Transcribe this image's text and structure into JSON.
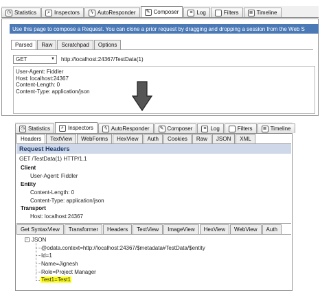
{
  "top": {
    "tabs": [
      {
        "label": "Statistics",
        "icon": "stopwatch-icon"
      },
      {
        "label": "Inspectors",
        "icon": "magnifier-icon"
      },
      {
        "label": "AutoResponder",
        "icon": "lightning-icon"
      },
      {
        "label": "Composer",
        "icon": "pencil-icon",
        "active": true
      },
      {
        "label": "Log",
        "icon": "log-icon"
      },
      {
        "label": "Filters",
        "icon": "checkbox-icon"
      },
      {
        "label": "Timeline",
        "icon": "timeline-icon"
      }
    ],
    "info": "Use this page to compose a Request. You can clone a prior request by dragging and dropping a session from the Web S",
    "subtabs": [
      "Parsed",
      "Raw",
      "Scratchpad",
      "Options"
    ],
    "method": "GET",
    "url": "http://localhost:24367/TestData(1)",
    "headers_text": "User-Agent: Fiddler\nHost: localhost:24367\nContent-Length: 0\nContent-Type: application/json"
  },
  "bottom": {
    "tabs": [
      {
        "label": "Statistics",
        "icon": "stopwatch-icon"
      },
      {
        "label": "Inspectors",
        "icon": "magnifier-icon",
        "active": true
      },
      {
        "label": "AutoResponder",
        "icon": "lightning-icon"
      },
      {
        "label": "Composer",
        "icon": "pencil-icon"
      },
      {
        "label": "Log",
        "icon": "log-icon"
      },
      {
        "label": "Filters",
        "icon": "checkbox-icon"
      },
      {
        "label": "Timeline",
        "icon": "timeline-icon"
      }
    ],
    "request_tabs": [
      "Headers",
      "TextView",
      "WebForms",
      "HexView",
      "Auth",
      "Cookies",
      "Raw",
      "JSON",
      "XML"
    ],
    "request_headers_title": "Request Headers",
    "request_line": "GET /TestData(1) HTTP/1.1",
    "groups": {
      "client": {
        "title": "Client",
        "items": [
          "User-Agent: Fiddler"
        ]
      },
      "entity": {
        "title": "Entity",
        "items": [
          "Content-Length: 0",
          "Content-Type: application/json"
        ]
      },
      "transport": {
        "title": "Transport",
        "items": [
          "Host: localhost:24367"
        ]
      }
    },
    "response_tabs": [
      "Get SyntaxView",
      "Transformer",
      "Headers",
      "TextView",
      "ImageView",
      "HexView",
      "WebView",
      "Auth"
    ],
    "json_tree": {
      "root": "JSON",
      "expander": "−",
      "items": [
        "@odata.context=http://localhost:24367/$metadata#TestData/$entity",
        "Id=1",
        "Name=Jignesh",
        "Role=Project Manager",
        "Test1=Test1"
      ],
      "highlight_color": "#ffff1a"
    }
  }
}
